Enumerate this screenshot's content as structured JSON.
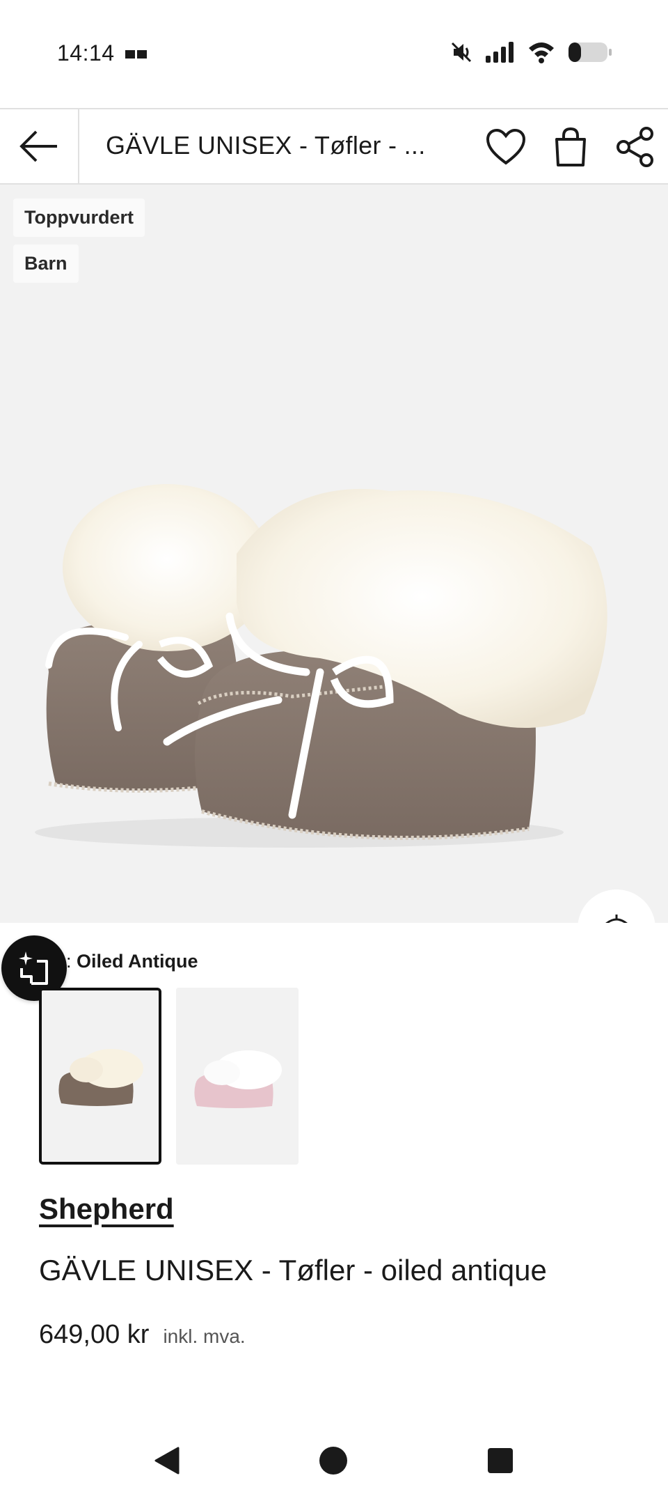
{
  "status_bar": {
    "time": "14:14",
    "icons": [
      "notification-icon",
      "mute-icon",
      "signal-icon",
      "wifi-icon",
      "battery-icon"
    ]
  },
  "header": {
    "title": "GÄVLE UNISEX - Tøfler - ...",
    "icons": [
      "back-arrow-icon",
      "heart-icon",
      "bag-icon",
      "share-icon"
    ]
  },
  "product_image": {
    "badges": [
      "Toppvurdert",
      "Barn"
    ]
  },
  "color": {
    "label_visible": "rge: ",
    "value": "Oiled Antique",
    "swatches": [
      {
        "name": "Oiled Antique",
        "selected": true
      },
      {
        "name": "Pink",
        "selected": false
      }
    ]
  },
  "product": {
    "brand": "Shepherd",
    "name": "GÄVLE UNISEX - Tøfler - oiled antique",
    "price": "649,00 kr",
    "tax_note": "inkl. mva."
  },
  "colors": {
    "image_bg": "#f2f2f2",
    "text": "#1a1a1a",
    "divider": "#e0e0e0",
    "suede": "#8a7b70",
    "fur": "#fbf7ee"
  }
}
